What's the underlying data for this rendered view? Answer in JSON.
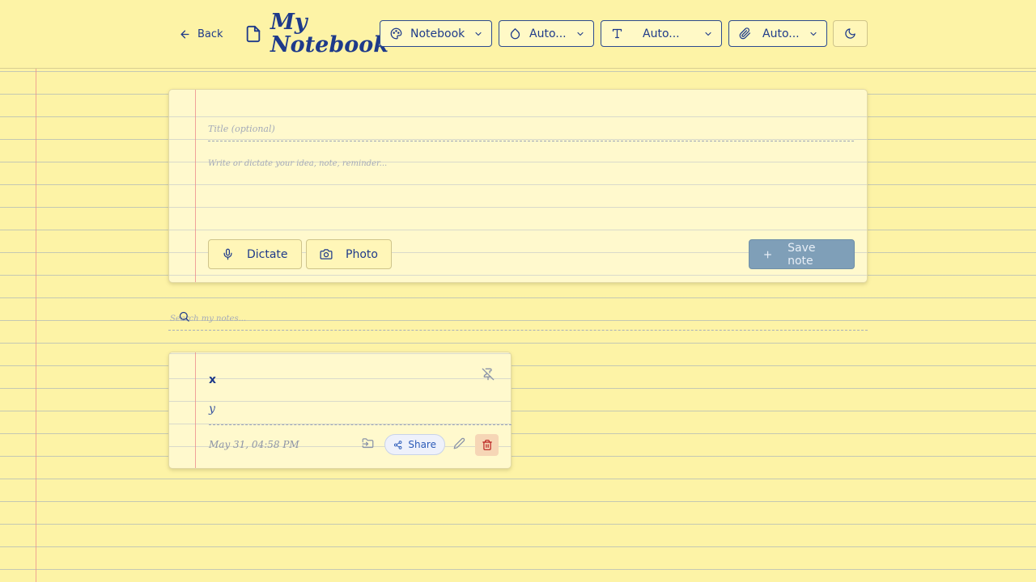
{
  "header": {
    "back_label": "Back",
    "app_title": "My Notebook",
    "selectors": [
      {
        "label": "Notebook",
        "icon": "palette-icon"
      },
      {
        "label": "Auto...",
        "icon": "droplet-icon"
      },
      {
        "label": "Auto...",
        "icon": "type-icon"
      },
      {
        "label": "Auto...",
        "icon": "paperclip-icon"
      }
    ],
    "theme_icon": "moon-icon"
  },
  "composer": {
    "title_placeholder": "Title (optional)",
    "body_placeholder": "Write or dictate your idea, note, reminder...",
    "dictate_label": "Dictate",
    "photo_label": "Photo",
    "save_label": "Save note"
  },
  "search": {
    "placeholder": "Search my notes..."
  },
  "notes": [
    {
      "title": "x",
      "body": "y",
      "date": "May 31, 04:58 PM",
      "share_label": "Share"
    }
  ],
  "colors": {
    "paper": "#fdf3a6",
    "ink": "#1e3a8a",
    "margin_line": "#ec8c8c",
    "save_button": "#7f9fb8",
    "delete_bg": "#f6d6b6",
    "delete_icon": "#b91c1c"
  }
}
